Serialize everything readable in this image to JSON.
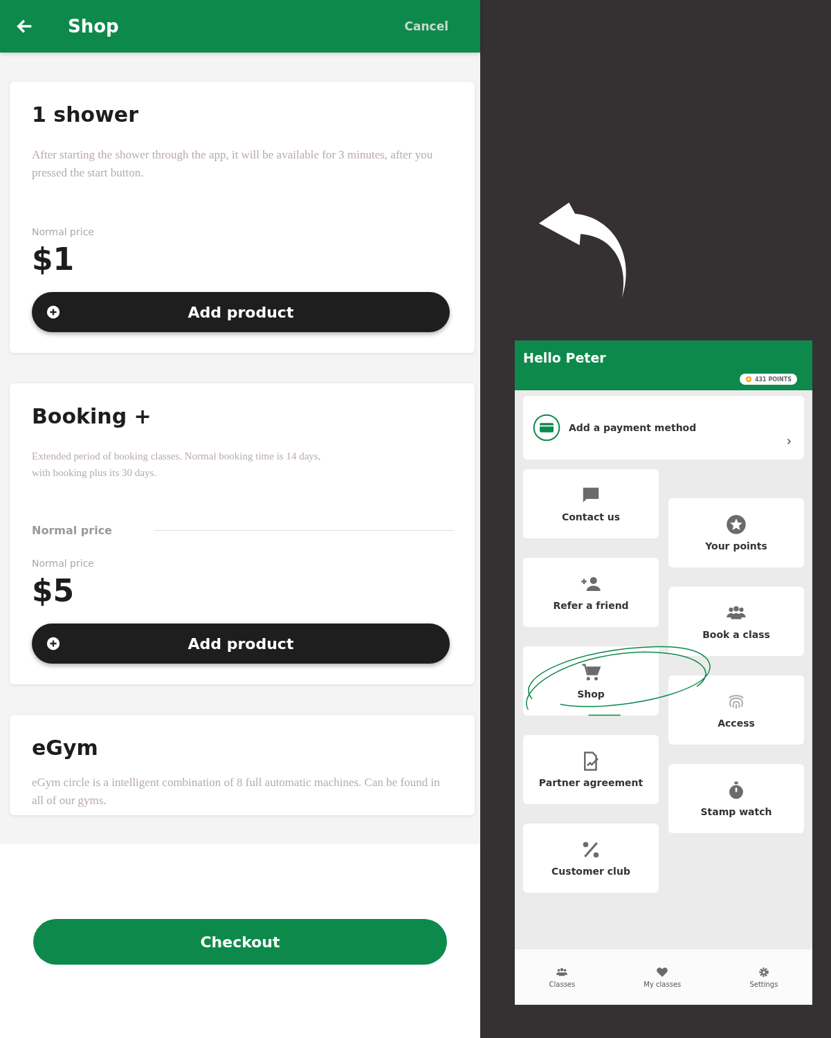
{
  "shop_screen": {
    "title": "Shop",
    "cancel": "Cancel",
    "products": [
      {
        "title": "1 shower",
        "description": "After starting the shower through the app, it will be available for 3 minutes, after you pressed the start button.",
        "price_label": "Normal price",
        "price": "$1",
        "button": "Add product"
      },
      {
        "title": "Booking +",
        "description": "Extended period of booking classes. Normal booking time is 14 days, with booking plus its 30 days.",
        "option_label": "Normal price",
        "price_label": "Normal price",
        "price": "$5",
        "button": "Add product"
      },
      {
        "title": "eGym",
        "description": "eGym circle is a intelligent combination of 8 full automatic machines. Can be found in all of our gyms."
      }
    ],
    "checkout": "Checkout"
  },
  "home_screen": {
    "greeting": "Hello Peter",
    "points": "431 POINTS",
    "payment": "Add a payment method",
    "tiles": [
      {
        "label": "Contact us",
        "kind": "chat",
        "circled": false
      },
      {
        "label": "Your points",
        "kind": "star",
        "circled": false
      },
      {
        "label": "Refer a friend",
        "kind": "person-add",
        "circled": false
      },
      {
        "label": "Book a class",
        "kind": "group",
        "circled": false
      },
      {
        "label": "Shop",
        "kind": "cart",
        "circled": true
      },
      {
        "label": "Access",
        "kind": "fingerprint",
        "circled": false
      },
      {
        "label": "Partner agreement",
        "kind": "document",
        "circled": false
      },
      {
        "label": "Stamp watch",
        "kind": "timer",
        "circled": false
      },
      {
        "label": "Customer club",
        "kind": "percent",
        "circled": false
      }
    ],
    "nav": [
      {
        "label": "Classes",
        "kind": "group"
      },
      {
        "label": "My classes",
        "kind": "heart"
      },
      {
        "label": "Settings",
        "kind": "gear"
      }
    ]
  }
}
